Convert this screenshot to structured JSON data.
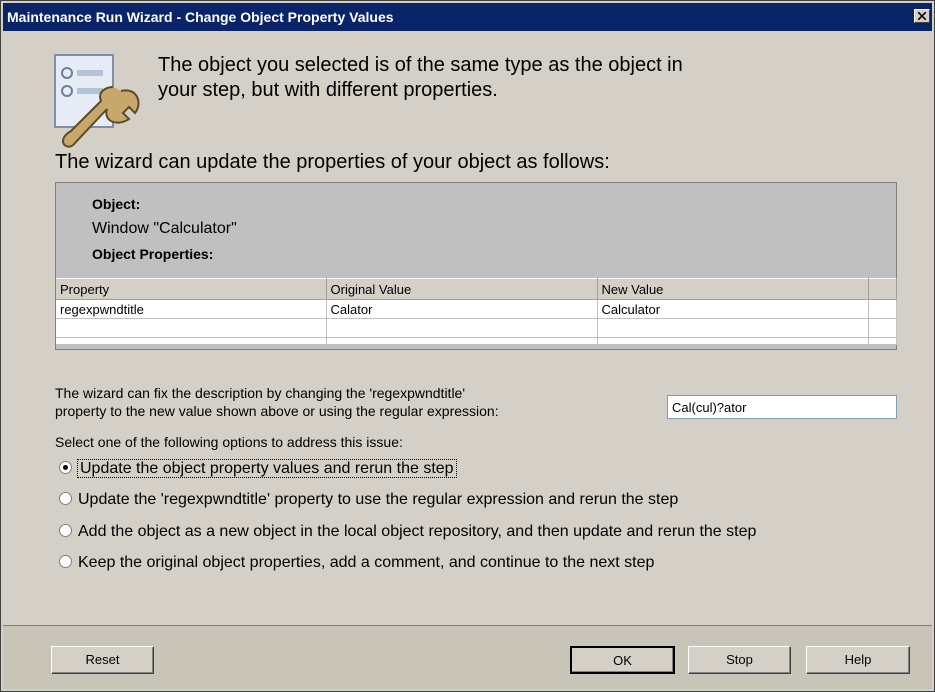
{
  "window": {
    "title": "Maintenance Run Wizard - Change Object Property Values"
  },
  "intro": {
    "line1": "The object you selected is of the same type as the object in",
    "line2": "your step, but with different properties."
  },
  "heading": "The wizard can update the properties of your object as follows:",
  "object_panel": {
    "object_label": "Object:",
    "object_value": "Window \"Calculator\"",
    "properties_label": "Object Properties:",
    "columns": [
      "Property",
      "Original Value",
      "New Value"
    ],
    "rows": [
      {
        "property": "regexpwndtitle",
        "original": "Calator",
        "new": "Calculator"
      }
    ]
  },
  "description": {
    "line1": "The wizard can fix the description by changing the 'regexpwndtitle'",
    "line2": "property to the new value shown above or using the regular expression:",
    "regex_value": "Cal(cul)?ator"
  },
  "options_prompt": "Select one of the following options to address this issue:",
  "options": [
    {
      "label": "Update the object property values and rerun the step",
      "checked": true
    },
    {
      "label": "Update the 'regexpwndtitle' property to use the regular expression and rerun the step",
      "checked": false
    },
    {
      "label": "Add the object as a new object in the local object repository, and then update and rerun the step",
      "checked": false
    },
    {
      "label": "Keep the original object properties, add a comment, and continue to the next step",
      "checked": false
    }
  ],
  "buttons": {
    "reset": "Reset",
    "ok": "OK",
    "stop": "Stop",
    "help": "Help"
  },
  "icons": {
    "wizard_icon": "settings-wrench-icon",
    "close_icon": "close-icon"
  }
}
